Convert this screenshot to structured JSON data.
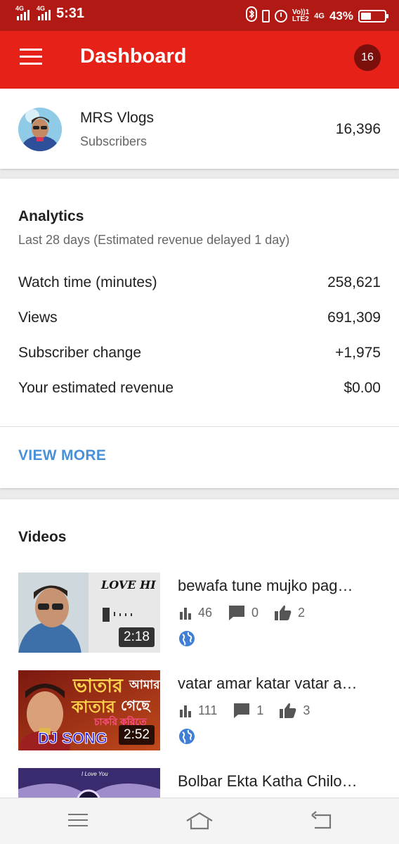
{
  "status_bar": {
    "network1": "4G",
    "network2": "4G",
    "time": "5:31",
    "volte_top": "Vo))1",
    "volte_bottom": "LTE2",
    "network3": "4G",
    "battery": "43%",
    "battery_level": 0.43
  },
  "app_bar": {
    "title": "Dashboard",
    "notification_count": "16",
    "accent": "#e62117"
  },
  "channel": {
    "name": "MRS Vlogs",
    "subscribers_label": "Subscribers",
    "subscribers_count": "16,396"
  },
  "analytics": {
    "title": "Analytics",
    "subtitle": "Last 28 days (Estimated revenue delayed 1 day)",
    "rows": [
      {
        "label": "Watch time (minutes)",
        "value": "258,621"
      },
      {
        "label": "Views",
        "value": "691,309"
      },
      {
        "label": "Subscriber change",
        "value": "+1,975"
      },
      {
        "label": "Your estimated revenue",
        "value": "$0.00"
      }
    ],
    "view_more": "VIEW MORE",
    "link_color": "#4a90d9"
  },
  "videos": {
    "title": "Videos",
    "items": [
      {
        "title": "bewafa tune mujko pag…",
        "duration": "2:18",
        "views": "46",
        "comments": "0",
        "likes": "2",
        "thumb_text": "LOVE HI"
      },
      {
        "title": "vatar amar katar vatar a…",
        "duration": "2:52",
        "views": "111",
        "comments": "1",
        "likes": "3",
        "thumb_text_1": "ভাতার",
        "thumb_text_2": "আমার",
        "thumb_text_3": "কাতার",
        "thumb_text_4": "গেছে",
        "thumb_text_5": "চাকরি করিতে",
        "thumb_text_6": "DJ SONG"
      },
      {
        "title": "Bolbar Ekta Katha Chilo…",
        "thumb_text": "I Love You"
      }
    ]
  },
  "nav": {
    "menu": "menu-icon",
    "home": "home-icon",
    "back": "back-icon"
  }
}
